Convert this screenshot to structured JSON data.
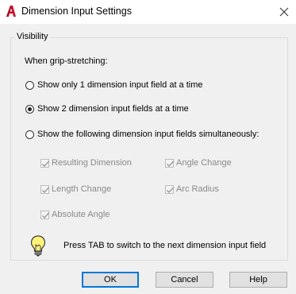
{
  "window": {
    "title": "Dimension Input Settings",
    "app_icon": "autocad-a-icon",
    "close_icon": "close-icon"
  },
  "visibility": {
    "group_label": "Visibility",
    "subheading": "When grip-stretching:",
    "radios": [
      {
        "label": "Show only 1 dimension input field at a time",
        "checked": false
      },
      {
        "label": "Show 2 dimension input fields at a time",
        "checked": true
      },
      {
        "label": "Show the following dimension input fields simultaneously:",
        "checked": false
      }
    ],
    "checkboxes": [
      {
        "label": "Resulting Dimension",
        "checked": true,
        "enabled": false
      },
      {
        "label": "Angle Change",
        "checked": true,
        "enabled": false
      },
      {
        "label": "Length Change",
        "checked": true,
        "enabled": false
      },
      {
        "label": "Arc Radius",
        "checked": true,
        "enabled": false
      },
      {
        "label": "Absolute Angle",
        "checked": true,
        "enabled": false
      }
    ],
    "tip_icon": "lightbulb-icon",
    "tip_text": "Press TAB to switch to the next dimension input field"
  },
  "buttons": {
    "ok": "OK",
    "cancel": "Cancel",
    "help": "Help"
  }
}
